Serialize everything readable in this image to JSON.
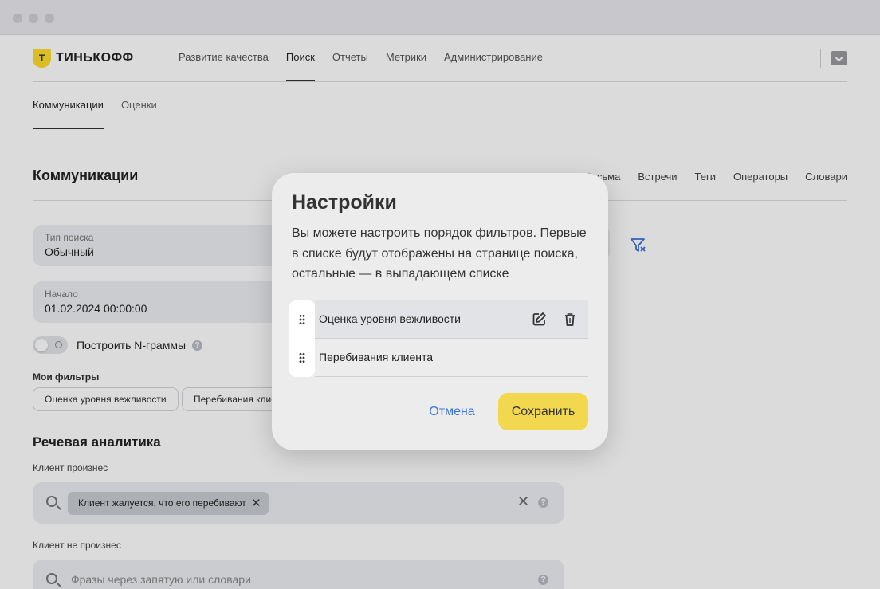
{
  "brand": {
    "logo_letter": "Т",
    "name": "ТИНЬКОФФ",
    "accent": "#ffdd2d"
  },
  "topnav": [
    {
      "label": "Развитие качества",
      "active": false
    },
    {
      "label": "Поиск",
      "active": true
    },
    {
      "label": "Отчеты",
      "active": false
    },
    {
      "label": "Метрики",
      "active": false
    },
    {
      "label": "Администрирование",
      "active": false
    }
  ],
  "subnav": [
    {
      "label": "Коммуникации",
      "active": true
    },
    {
      "label": "Оценки",
      "active": false
    }
  ],
  "page": {
    "title": "Коммуникации",
    "right_tabs": [
      "Письма",
      "Встречи",
      "Теги",
      "Операторы",
      "Словари"
    ]
  },
  "form": {
    "search_type": {
      "label": "Тип поиска",
      "value": "Обычный"
    },
    "start": {
      "label": "Начало",
      "value": "01.02.2024 00:00:00"
    },
    "ngrams": {
      "label": "Построить N-граммы",
      "enabled": false
    },
    "my_filters_title": "Мои фильтры",
    "my_filters": [
      "Оценка уровня вежливости",
      "Перебивания клиента"
    ]
  },
  "speech": {
    "title": "Речевая аналитика",
    "client_said_label": "Клиент произнес",
    "client_said_tag": "Клиент жалуется, что его перебивают",
    "client_not_said_label": "Клиент не произнес",
    "client_not_said_placeholder": "Фразы через запятую или словари"
  },
  "modal": {
    "title": "Настройки",
    "description": "Вы можете настроить порядок фильтров. Первые в списке будут отображены на странице поиска, остальные — в выпадающем списке",
    "items": [
      "Оценка уровня вежливости",
      "Перебивания клиента"
    ],
    "cancel_label": "Отмена",
    "save_label": "Сохранить",
    "save_color": "#f2d84f",
    "link_color": "#3c74d8"
  }
}
